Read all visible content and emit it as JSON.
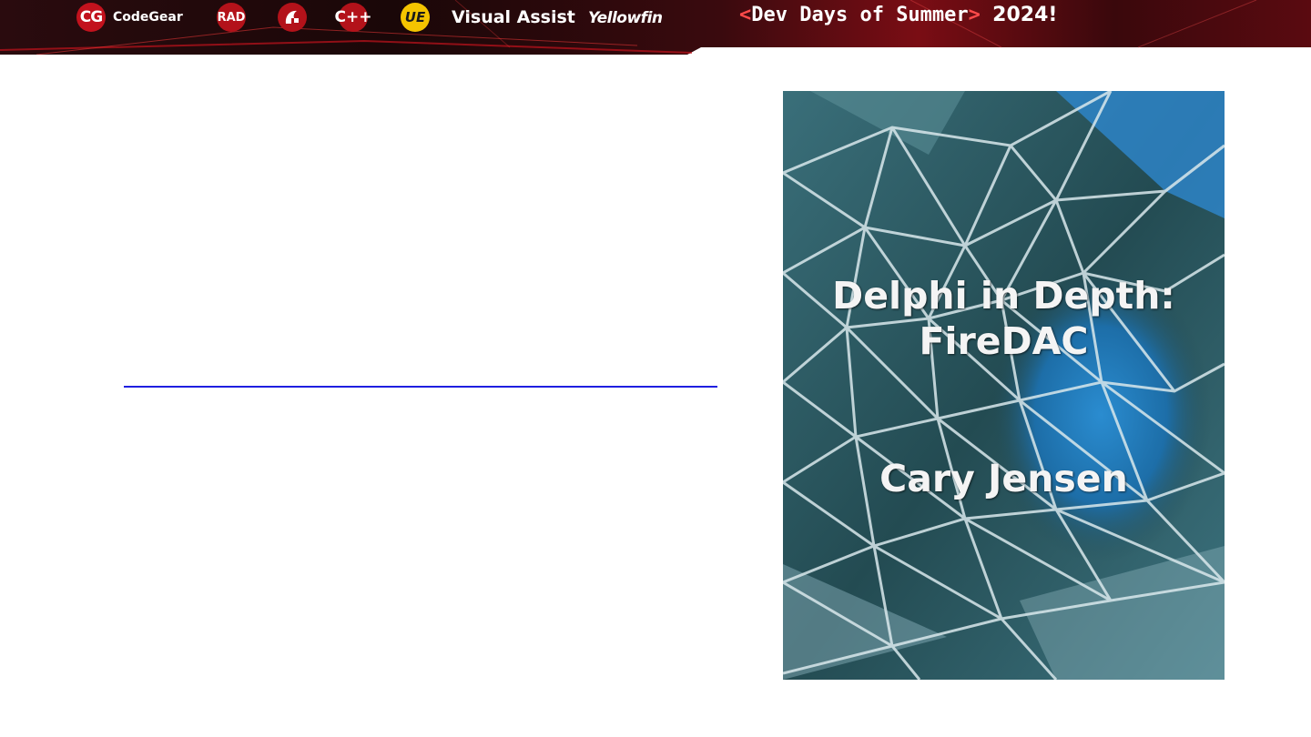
{
  "banner": {
    "logos": {
      "codegear_mark": "CG",
      "codegear_text": "CodeGear",
      "rad_mark": "RAD",
      "cpp_mark": "C++",
      "ue_mark": "UE",
      "visual_assist_text": "Visual Assist",
      "yellowfin_text": "Yellowfin"
    },
    "event": {
      "open_bracket": "<",
      "title": "Dev Days of Summer",
      "close_bracket": ">",
      "year": "2024!"
    },
    "colors": {
      "accent": "#c2121d",
      "background": "#1a0a0c"
    }
  },
  "main": {
    "link_color": "#1f1fe0"
  },
  "book_cover": {
    "title_line1": "Delphi in Depth:",
    "title_line2": "FireDAC",
    "author": "Cary Jensen"
  }
}
